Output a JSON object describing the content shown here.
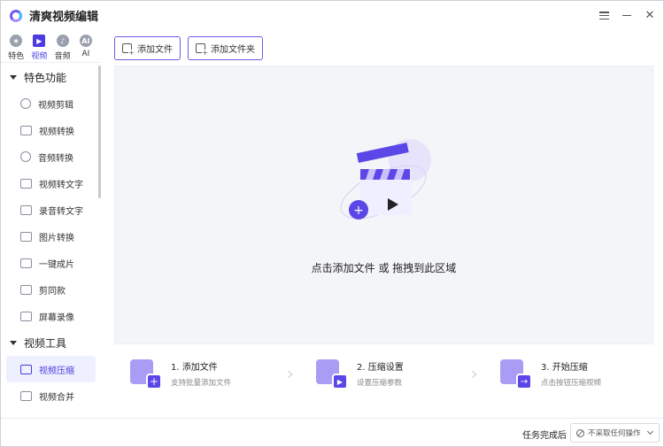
{
  "app": {
    "title": "清爽视频编辑"
  },
  "mode_tabs": [
    {
      "label": "特色",
      "icon": "star-icon",
      "glyph": "★",
      "active": false
    },
    {
      "label": "视频",
      "icon": "video-icon",
      "glyph": "▶",
      "active": true
    },
    {
      "label": "音频",
      "icon": "audio-icon",
      "glyph": "♪",
      "active": false
    },
    {
      "label": "AI",
      "icon": "ai-icon",
      "glyph": "AI",
      "active": false
    }
  ],
  "sidebar": {
    "section1": {
      "label": "特色功能"
    },
    "section1_items": [
      {
        "label": "视频剪辑",
        "icon": "video-edit-icon"
      },
      {
        "label": "视频转换",
        "icon": "video-convert-icon"
      },
      {
        "label": "音频转换",
        "icon": "microphone-icon"
      },
      {
        "label": "视频转文字",
        "icon": "video-to-text-icon"
      },
      {
        "label": "录音转文字",
        "icon": "audio-to-text-icon"
      },
      {
        "label": "图片转换",
        "icon": "image-icon"
      },
      {
        "label": "一键成片",
        "icon": "one-click-video-icon"
      },
      {
        "label": "剪同款",
        "icon": "template-icon"
      },
      {
        "label": "屏幕录像",
        "icon": "screen-record-icon"
      }
    ],
    "section2": {
      "label": "视频工具"
    },
    "section2_items": [
      {
        "label": "视频压缩",
        "icon": "video-compress-icon",
        "active": true
      },
      {
        "label": "视频合并",
        "icon": "video-merge-icon"
      }
    ]
  },
  "toolbar": {
    "add_file": "添加文件",
    "add_folder": "添加文件夹"
  },
  "dropzone": {
    "text": "点击添加文件 或 拖拽到此区域"
  },
  "steps": [
    {
      "title": "1. 添加文件",
      "subtitle": "支持批量添加文件",
      "icon": "add-file-step-icon",
      "glyph": "+"
    },
    {
      "title": "2. 压缩设置",
      "subtitle": "设置压缩参数",
      "icon": "compress-settings-step-icon",
      "glyph": "▶"
    },
    {
      "title": "3. 开始压缩",
      "subtitle": "点击按钮压缩视频",
      "icon": "start-compress-step-icon",
      "glyph": "→"
    }
  ],
  "status": {
    "after_label": "任务完成后",
    "after_value": "不采取任何操作"
  },
  "colors": {
    "accent": "#4a3ce0",
    "accent_light": "#a99cf5",
    "dropzone_bg": "#f4f5f8"
  }
}
